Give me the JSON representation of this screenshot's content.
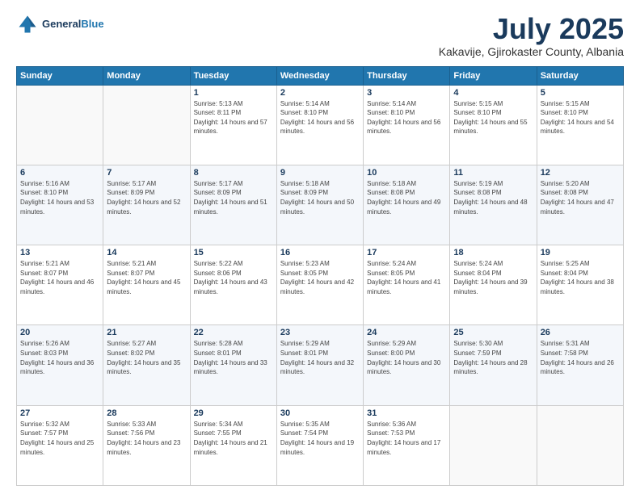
{
  "logo": {
    "line1": "General",
    "line2": "Blue"
  },
  "header": {
    "title": "July 2025",
    "subtitle": "Kakavije, Gjirokaster County, Albania"
  },
  "weekdays": [
    "Sunday",
    "Monday",
    "Tuesday",
    "Wednesday",
    "Thursday",
    "Friday",
    "Saturday"
  ],
  "weeks": [
    [
      {
        "day": "",
        "sunrise": "",
        "sunset": "",
        "daylight": ""
      },
      {
        "day": "",
        "sunrise": "",
        "sunset": "",
        "daylight": ""
      },
      {
        "day": "1",
        "sunrise": "Sunrise: 5:13 AM",
        "sunset": "Sunset: 8:11 PM",
        "daylight": "Daylight: 14 hours and 57 minutes."
      },
      {
        "day": "2",
        "sunrise": "Sunrise: 5:14 AM",
        "sunset": "Sunset: 8:10 PM",
        "daylight": "Daylight: 14 hours and 56 minutes."
      },
      {
        "day": "3",
        "sunrise": "Sunrise: 5:14 AM",
        "sunset": "Sunset: 8:10 PM",
        "daylight": "Daylight: 14 hours and 56 minutes."
      },
      {
        "day": "4",
        "sunrise": "Sunrise: 5:15 AM",
        "sunset": "Sunset: 8:10 PM",
        "daylight": "Daylight: 14 hours and 55 minutes."
      },
      {
        "day": "5",
        "sunrise": "Sunrise: 5:15 AM",
        "sunset": "Sunset: 8:10 PM",
        "daylight": "Daylight: 14 hours and 54 minutes."
      }
    ],
    [
      {
        "day": "6",
        "sunrise": "Sunrise: 5:16 AM",
        "sunset": "Sunset: 8:10 PM",
        "daylight": "Daylight: 14 hours and 53 minutes."
      },
      {
        "day": "7",
        "sunrise": "Sunrise: 5:17 AM",
        "sunset": "Sunset: 8:09 PM",
        "daylight": "Daylight: 14 hours and 52 minutes."
      },
      {
        "day": "8",
        "sunrise": "Sunrise: 5:17 AM",
        "sunset": "Sunset: 8:09 PM",
        "daylight": "Daylight: 14 hours and 51 minutes."
      },
      {
        "day": "9",
        "sunrise": "Sunrise: 5:18 AM",
        "sunset": "Sunset: 8:09 PM",
        "daylight": "Daylight: 14 hours and 50 minutes."
      },
      {
        "day": "10",
        "sunrise": "Sunrise: 5:18 AM",
        "sunset": "Sunset: 8:08 PM",
        "daylight": "Daylight: 14 hours and 49 minutes."
      },
      {
        "day": "11",
        "sunrise": "Sunrise: 5:19 AM",
        "sunset": "Sunset: 8:08 PM",
        "daylight": "Daylight: 14 hours and 48 minutes."
      },
      {
        "day": "12",
        "sunrise": "Sunrise: 5:20 AM",
        "sunset": "Sunset: 8:08 PM",
        "daylight": "Daylight: 14 hours and 47 minutes."
      }
    ],
    [
      {
        "day": "13",
        "sunrise": "Sunrise: 5:21 AM",
        "sunset": "Sunset: 8:07 PM",
        "daylight": "Daylight: 14 hours and 46 minutes."
      },
      {
        "day": "14",
        "sunrise": "Sunrise: 5:21 AM",
        "sunset": "Sunset: 8:07 PM",
        "daylight": "Daylight: 14 hours and 45 minutes."
      },
      {
        "day": "15",
        "sunrise": "Sunrise: 5:22 AM",
        "sunset": "Sunset: 8:06 PM",
        "daylight": "Daylight: 14 hours and 43 minutes."
      },
      {
        "day": "16",
        "sunrise": "Sunrise: 5:23 AM",
        "sunset": "Sunset: 8:05 PM",
        "daylight": "Daylight: 14 hours and 42 minutes."
      },
      {
        "day": "17",
        "sunrise": "Sunrise: 5:24 AM",
        "sunset": "Sunset: 8:05 PM",
        "daylight": "Daylight: 14 hours and 41 minutes."
      },
      {
        "day": "18",
        "sunrise": "Sunrise: 5:24 AM",
        "sunset": "Sunset: 8:04 PM",
        "daylight": "Daylight: 14 hours and 39 minutes."
      },
      {
        "day": "19",
        "sunrise": "Sunrise: 5:25 AM",
        "sunset": "Sunset: 8:04 PM",
        "daylight": "Daylight: 14 hours and 38 minutes."
      }
    ],
    [
      {
        "day": "20",
        "sunrise": "Sunrise: 5:26 AM",
        "sunset": "Sunset: 8:03 PM",
        "daylight": "Daylight: 14 hours and 36 minutes."
      },
      {
        "day": "21",
        "sunrise": "Sunrise: 5:27 AM",
        "sunset": "Sunset: 8:02 PM",
        "daylight": "Daylight: 14 hours and 35 minutes."
      },
      {
        "day": "22",
        "sunrise": "Sunrise: 5:28 AM",
        "sunset": "Sunset: 8:01 PM",
        "daylight": "Daylight: 14 hours and 33 minutes."
      },
      {
        "day": "23",
        "sunrise": "Sunrise: 5:29 AM",
        "sunset": "Sunset: 8:01 PM",
        "daylight": "Daylight: 14 hours and 32 minutes."
      },
      {
        "day": "24",
        "sunrise": "Sunrise: 5:29 AM",
        "sunset": "Sunset: 8:00 PM",
        "daylight": "Daylight: 14 hours and 30 minutes."
      },
      {
        "day": "25",
        "sunrise": "Sunrise: 5:30 AM",
        "sunset": "Sunset: 7:59 PM",
        "daylight": "Daylight: 14 hours and 28 minutes."
      },
      {
        "day": "26",
        "sunrise": "Sunrise: 5:31 AM",
        "sunset": "Sunset: 7:58 PM",
        "daylight": "Daylight: 14 hours and 26 minutes."
      }
    ],
    [
      {
        "day": "27",
        "sunrise": "Sunrise: 5:32 AM",
        "sunset": "Sunset: 7:57 PM",
        "daylight": "Daylight: 14 hours and 25 minutes."
      },
      {
        "day": "28",
        "sunrise": "Sunrise: 5:33 AM",
        "sunset": "Sunset: 7:56 PM",
        "daylight": "Daylight: 14 hours and 23 minutes."
      },
      {
        "day": "29",
        "sunrise": "Sunrise: 5:34 AM",
        "sunset": "Sunset: 7:55 PM",
        "daylight": "Daylight: 14 hours and 21 minutes."
      },
      {
        "day": "30",
        "sunrise": "Sunrise: 5:35 AM",
        "sunset": "Sunset: 7:54 PM",
        "daylight": "Daylight: 14 hours and 19 minutes."
      },
      {
        "day": "31",
        "sunrise": "Sunrise: 5:36 AM",
        "sunset": "Sunset: 7:53 PM",
        "daylight": "Daylight: 14 hours and 17 minutes."
      },
      {
        "day": "",
        "sunrise": "",
        "sunset": "",
        "daylight": ""
      },
      {
        "day": "",
        "sunrise": "",
        "sunset": "",
        "daylight": ""
      }
    ]
  ]
}
